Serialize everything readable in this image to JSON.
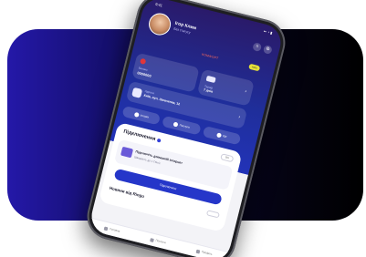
{
  "status": {
    "time": "9:41",
    "indicators": "▪▪ ◔ ▮"
  },
  "profile": {
    "name": "Ігор Клим",
    "subtitle": "Без статусу"
  },
  "bonus": {
    "label": "КОМФОРТ",
    "badge": "+5%"
  },
  "cards": {
    "balance": {
      "label": "Баланс",
      "value": "0000000"
    },
    "tariff": {
      "label": "Тариф",
      "value": "7 днів"
    },
    "address": {
      "label": "Адреса",
      "value": "Київ, вул. Шевченка, 12"
    }
  },
  "chips": [
    "Історія",
    "Послуги",
    "Ще"
  ],
  "sheet": {
    "title": "Підключення",
    "button": "Усі",
    "promo_title": "Підключіть домашній інтернет",
    "promo_subtitle": "Швидкість до 1 Гбіт/с",
    "cta": "Підключити",
    "section_title": "Новини від Ringo"
  },
  "tabbar": [
    "Головна",
    "Послуги",
    "Профіль"
  ],
  "colors": {
    "accent": "#2536c9",
    "bg_left": "#2418a8",
    "bg_right": "#000000"
  }
}
